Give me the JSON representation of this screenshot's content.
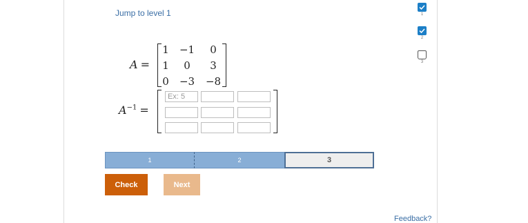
{
  "header": {
    "jump_link": "Jump to level 1"
  },
  "levels": [
    {
      "number": "1",
      "status": "completed",
      "icon": "checkmark-icon"
    },
    {
      "number": "2",
      "status": "completed",
      "icon": "checkmark-icon"
    },
    {
      "number": "3",
      "status": "current",
      "icon": "empty-box-icon"
    }
  ],
  "matrix_a": {
    "label": "A",
    "equals": "=",
    "rows": [
      [
        "1",
        "−1",
        "0"
      ],
      [
        "1",
        "0",
        "3"
      ],
      [
        "0",
        "−3",
        "−8"
      ]
    ]
  },
  "matrix_inverse": {
    "label": "A",
    "superscript": "−1",
    "equals": "=",
    "placeholder": "Ex: 5",
    "rows": [
      [
        "",
        "",
        ""
      ],
      [
        "",
        "",
        ""
      ],
      [
        "",
        "",
        ""
      ]
    ]
  },
  "progress": {
    "segments": [
      "1",
      "2",
      "3"
    ],
    "completed_segments": 2,
    "current_segment": 3
  },
  "buttons": {
    "check": "Check",
    "next": "Next"
  },
  "footer": {
    "feedback": "Feedback?"
  },
  "colors": {
    "accent_blue": "#1c7fc7",
    "progress_fill": "#88aed6",
    "check_button": "#cc5f09",
    "next_button_disabled": "#e9b98c",
    "link": "#3a6ea5"
  }
}
